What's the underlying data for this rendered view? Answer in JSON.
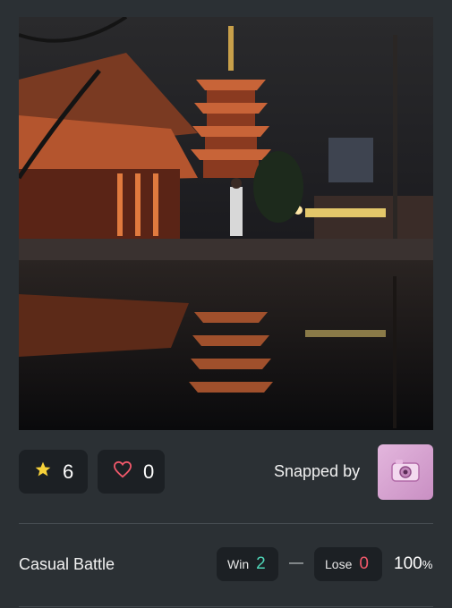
{
  "post": {
    "photo_icon": "snapshot-photo",
    "stars_count": "6",
    "likes_count": "0",
    "snapped_by_label": "Snapped by",
    "avatar_icon": "camera-icon"
  },
  "battle": {
    "mode_label": "Casual Battle",
    "win_label": "Win",
    "win_value": "2",
    "separator": "—",
    "lose_label": "Lose",
    "lose_value": "0",
    "win_rate_value": "100",
    "win_rate_unit": "%"
  },
  "colors": {
    "background": "#2b3034",
    "pill": "#1c2024",
    "star": "#f7d23a",
    "heart": "#f0586a",
    "win": "#4fd6b8",
    "lose": "#f0586a",
    "avatar": "#d6a3d0"
  }
}
